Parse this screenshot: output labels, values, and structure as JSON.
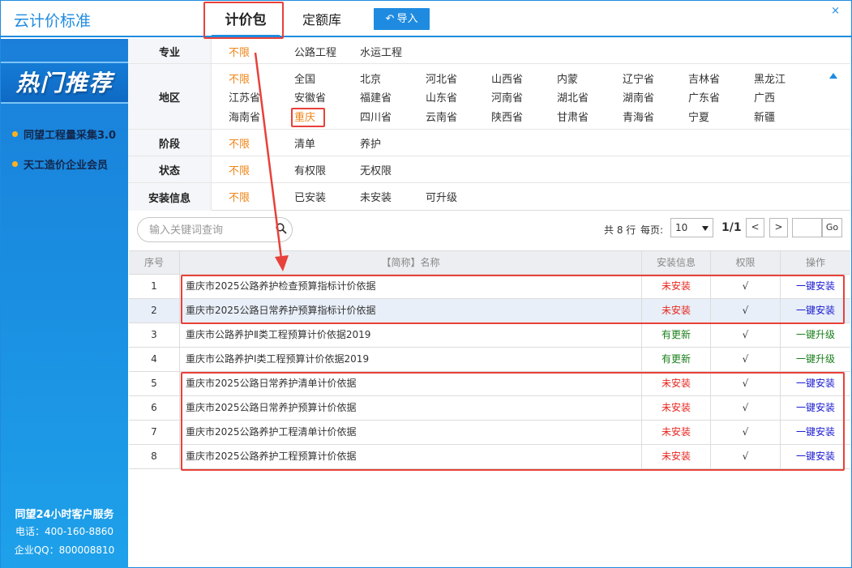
{
  "window": {
    "title": "云计价标准",
    "tabs": [
      {
        "label": "计价包"
      },
      {
        "label": "定额库"
      }
    ],
    "import_label": "导入",
    "close_glyph": "×"
  },
  "sidebar": {
    "banner": "热门推荐",
    "promos": [
      {
        "label": "同望工程量采集3.0"
      },
      {
        "label": "天工造价企业会员"
      }
    ],
    "service": {
      "title": "同望24小时客户服务",
      "phone": "电话：400-160-8860",
      "qq": "企业QQ：800008810"
    }
  },
  "filters": {
    "major": {
      "label": "专业",
      "options": [
        "不限",
        "公路工程",
        "水运工程"
      ],
      "active": "不限"
    },
    "region": {
      "label": "地区",
      "options": [
        "不限",
        "全国",
        "北京",
        "河北省",
        "山西省",
        "内蒙",
        "辽宁省",
        "吉林省",
        "黑龙江",
        "江苏省",
        "安徽省",
        "福建省",
        "山东省",
        "河南省",
        "湖北省",
        "湖南省",
        "广东省",
        "广西",
        "海南省",
        "重庆",
        "四川省",
        "云南省",
        "陕西省",
        "甘肃省",
        "青海省",
        "宁夏",
        "新疆"
      ],
      "active": "重庆"
    },
    "stage": {
      "label": "阶段",
      "options": [
        "不限",
        "清单",
        "养护"
      ],
      "active": "不限"
    },
    "state": {
      "label": "状态",
      "options": [
        "不限",
        "有权限",
        "无权限"
      ],
      "active": "不限"
    },
    "install": {
      "label": "安装信息",
      "options": [
        "不限",
        "已安装",
        "未安装",
        "可升级"
      ],
      "active": "不限"
    }
  },
  "toolbar": {
    "search_placeholder": "输入关键词查询",
    "total": "共 8 行",
    "per_page_label": "每页:",
    "per_page": "10",
    "page": "1/1",
    "prev": "<",
    "next": ">",
    "go": "Go"
  },
  "table": {
    "headers": [
      "序号",
      "【简称】名称",
      "安装信息",
      "权限",
      "操作"
    ],
    "rows": [
      {
        "idx": "1",
        "name": "重庆市2025公路养护检查预算指标计价依据",
        "status": "未安装",
        "status_type": "red",
        "perm": "√",
        "op": "一键安装",
        "op_type": "blue"
      },
      {
        "idx": "2",
        "name": "重庆市2025公路日常养护预算指标计价依据",
        "status": "未安装",
        "status_type": "red",
        "perm": "√",
        "op": "一键安装",
        "op_type": "blue"
      },
      {
        "idx": "3",
        "name": "重庆市公路养护Ⅱ类工程预算计价依据2019",
        "status": "有更新",
        "status_type": "green",
        "perm": "√",
        "op": "一键升级",
        "op_type": "green"
      },
      {
        "idx": "4",
        "name": "重庆市公路养护Ⅰ类工程预算计价依据2019",
        "status": "有更新",
        "status_type": "green",
        "perm": "√",
        "op": "一键升级",
        "op_type": "green"
      },
      {
        "idx": "5",
        "name": "重庆市2025公路日常养护清单计价依据",
        "status": "未安装",
        "status_type": "red",
        "perm": "√",
        "op": "一键安装",
        "op_type": "blue"
      },
      {
        "idx": "6",
        "name": "重庆市2025公路日常养护预算计价依据",
        "status": "未安装",
        "status_type": "red",
        "perm": "√",
        "op": "一键安装",
        "op_type": "blue"
      },
      {
        "idx": "7",
        "name": "重庆市2025公路养护工程清单计价依据",
        "status": "未安装",
        "status_type": "red",
        "perm": "√",
        "op": "一键安装",
        "op_type": "blue"
      },
      {
        "idx": "8",
        "name": "重庆市2025公路养护工程预算计价依据",
        "status": "未安装",
        "status_type": "red",
        "perm": "√",
        "op": "一键安装",
        "op_type": "blue"
      }
    ],
    "selected_row": 2
  },
  "colors": {
    "accent": "#1f8be0",
    "active_filter": "#f08416",
    "annotation": "#e8413a",
    "not_installed": "#e6261f",
    "updated": "#1a7f1a",
    "install_link": "#1a1ad0"
  }
}
